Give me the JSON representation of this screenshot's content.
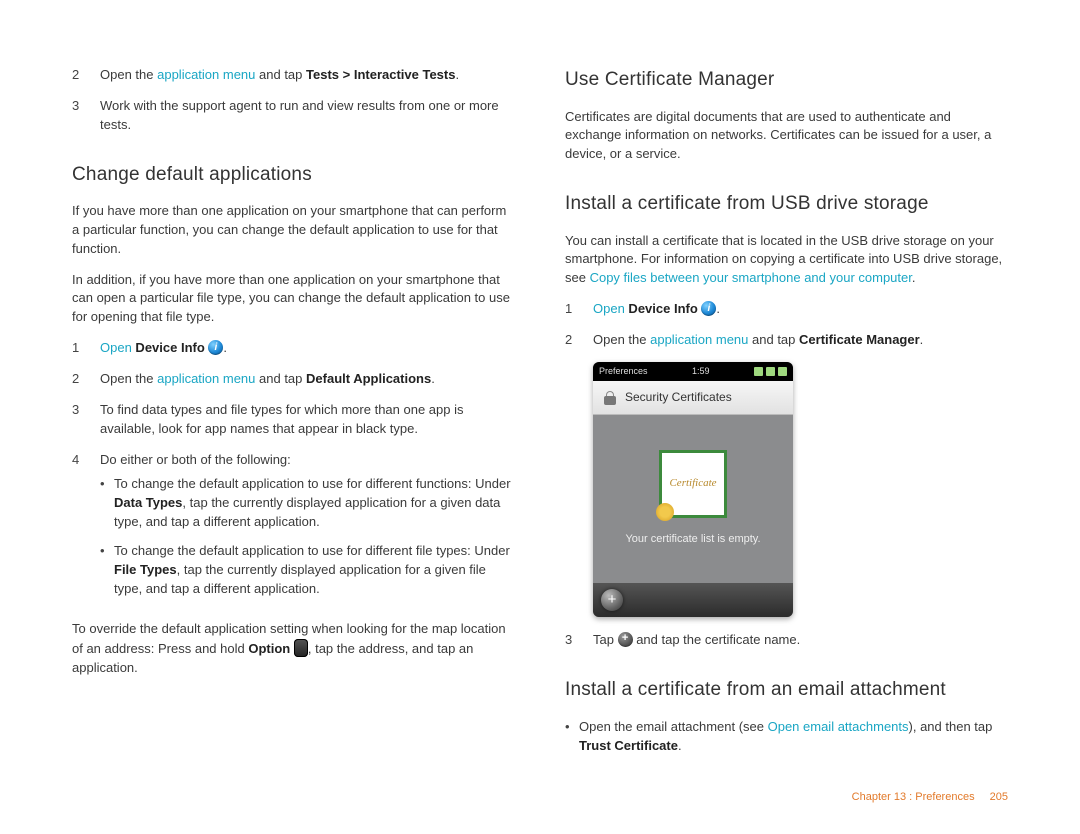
{
  "left": {
    "steps_a": [
      {
        "n": "2",
        "pre": "Open the ",
        "link": "application menu",
        "mid": " and tap ",
        "bold": "Tests > Interactive Tests",
        "post": "."
      },
      {
        "n": "3",
        "text": "Work with the support agent to run and view results from one or more tests."
      }
    ],
    "h1": "Change default applications",
    "p1": "If you have more than one application on your smartphone that can perform a particular function, you can change the default application to use for that function.",
    "p2": "In addition, if you have more than one application on your smartphone that can open a particular file type, you can change the default application to use for opening that file type.",
    "steps_b": {
      "s1": {
        "n": "1",
        "link": "Open",
        "bold": " Device Info",
        "post": " ",
        "icon": "info",
        "tail": "."
      },
      "s2": {
        "n": "2",
        "pre": "Open the ",
        "link": "application menu",
        "mid": " and tap ",
        "bold": "Default Applications",
        "post": "."
      },
      "s3": {
        "n": "3",
        "text": "To find data types and file types for which more than one app is available, look for app names that appear in black type."
      },
      "s4": {
        "n": "4",
        "text": "Do either or both of the following:",
        "b1": {
          "pre": "To change the default application to use for different functions: Under ",
          "bold": "Data Types",
          "post": ", tap the currently displayed application for a given data type, and tap a different application."
        },
        "b2": {
          "pre": "To change the default application to use for different file types: Under ",
          "bold": "File Types",
          "post": ", tap the currently displayed application for a given file type, and tap a different application."
        }
      }
    },
    "p3": {
      "pre": "To override the default application setting when looking for the map location of an address: Press and hold ",
      "bold": "Option",
      "mid": " ",
      "post": ", tap the address, and tap an application."
    }
  },
  "right": {
    "h1": "Use Certificate Manager",
    "p1": "Certificates are digital documents that are used to authenticate and exchange information on networks. Certificates can be issued for a user, a device, or a service.",
    "h2": "Install a certificate from USB drive storage",
    "p2": {
      "pre": "You can install a certificate that is located in the USB drive storage on your smartphone. For information on copying a certificate into USB drive storage, see ",
      "link": "Copy files between your smartphone and your computer",
      "post": "."
    },
    "steps": {
      "s1": {
        "n": "1",
        "link": "Open",
        "bold": " Device Info",
        "post": " ",
        "icon": "info",
        "tail": "."
      },
      "s2": {
        "n": "2",
        "pre": "Open the ",
        "link": "application menu",
        "mid": " and tap ",
        "bold": "Certificate Manager",
        "post": "."
      },
      "s3": {
        "n": "3",
        "pre": "Tap ",
        "post": " and tap the certificate name."
      }
    },
    "shot": {
      "status_left": "Preferences",
      "status_time": "1:59",
      "header": "Security Certificates",
      "badge": "Certificate",
      "empty": "Your certificate list is empty."
    },
    "h3": "Install a certificate from an email attachment",
    "b1": {
      "pre": "Open the email attachment (see ",
      "link": "Open email attachments",
      "mid": "), and then tap ",
      "bold": "Trust Certificate",
      "post": "."
    }
  },
  "footer": {
    "chapter": "Chapter 13 : Preferences",
    "page": "205"
  }
}
